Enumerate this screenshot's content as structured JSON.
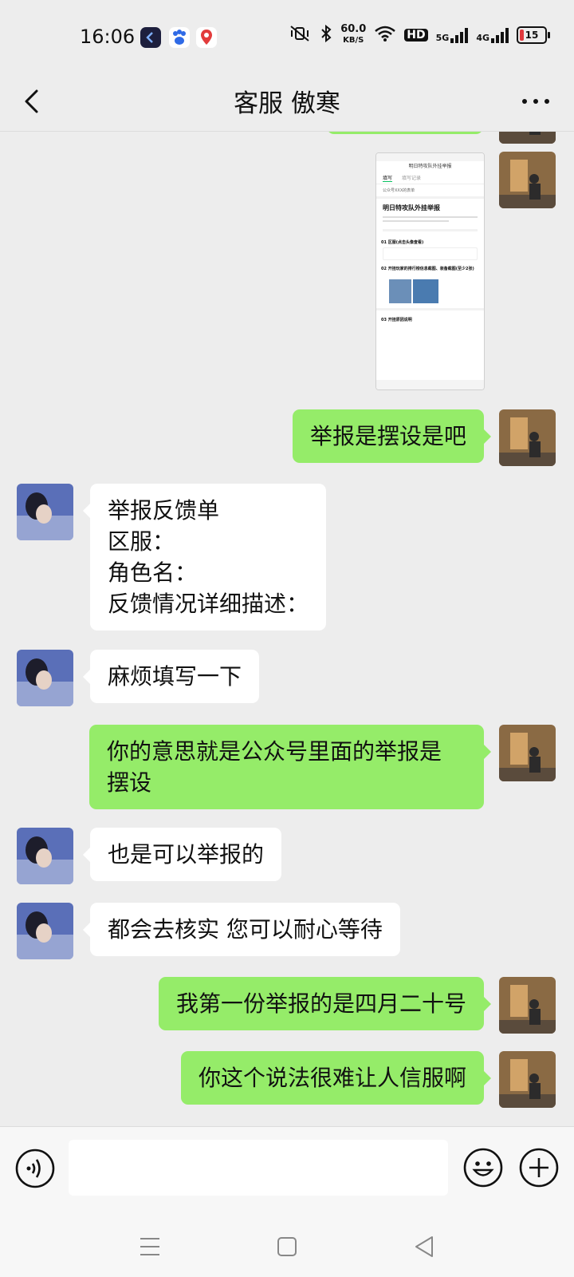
{
  "status_bar": {
    "time": "16:06",
    "net_speed_value": "60.0",
    "net_speed_unit": "KB/S",
    "hd_badge": "HD",
    "signal_1_label": "5G",
    "signal_2_label": "4G",
    "battery_level": "15",
    "app_icons": [
      "app-icon-dark",
      "baidu-paw-icon",
      "map-pin-icon"
    ],
    "system_icons": [
      "mute-vibrate-icon",
      "bluetooth-icon",
      "wifi-icon"
    ]
  },
  "header": {
    "title": "客服 傲寒",
    "back_icon": "chevron-left-icon",
    "more_icon": "more-dots-icon"
  },
  "screenshot_thumbnail": {
    "header_text": "明日特攻队外挂举报",
    "tab_1": "填写",
    "tab_2": "填写记录",
    "source_line": "公众号XXX的表单",
    "form_title": "明日特攻队外挂举报",
    "q1": "01  区服(点击头像查看)",
    "q2": "02  开挂玩家的排行榜信息截图、装备截图(至少2张)",
    "q3": "03  开挂原因说明"
  },
  "messages": [
    {
      "side": "me",
      "lines": [
        "举报是摆设是吧"
      ]
    },
    {
      "side": "other",
      "lines": [
        "举报反馈单",
        "区服：",
        "角色名：",
        "反馈情况详细描述："
      ]
    },
    {
      "side": "other",
      "lines": [
        "麻烦填写一下"
      ]
    },
    {
      "side": "me",
      "lines": [
        "你的意思就是公众号里面的举报是",
        "摆设"
      ]
    },
    {
      "side": "other",
      "lines": [
        "也是可以举报的"
      ]
    },
    {
      "side": "other",
      "lines": [
        "都会去核实 您可以耐心等待"
      ]
    },
    {
      "side": "me",
      "lines": [
        "我第一份举报的是四月二十号"
      ]
    },
    {
      "side": "me",
      "lines": [
        "你这个说法很难让人信服啊"
      ]
    }
  ],
  "input_bar": {
    "voice_icon": "voice-icon",
    "text_value": "",
    "emoji_icon": "emoji-icon",
    "plus_icon": "plus-icon"
  },
  "system_nav": {
    "menu_icon": "menu-icon",
    "home_icon": "home-square-icon",
    "back_icon": "back-triangle-icon"
  }
}
